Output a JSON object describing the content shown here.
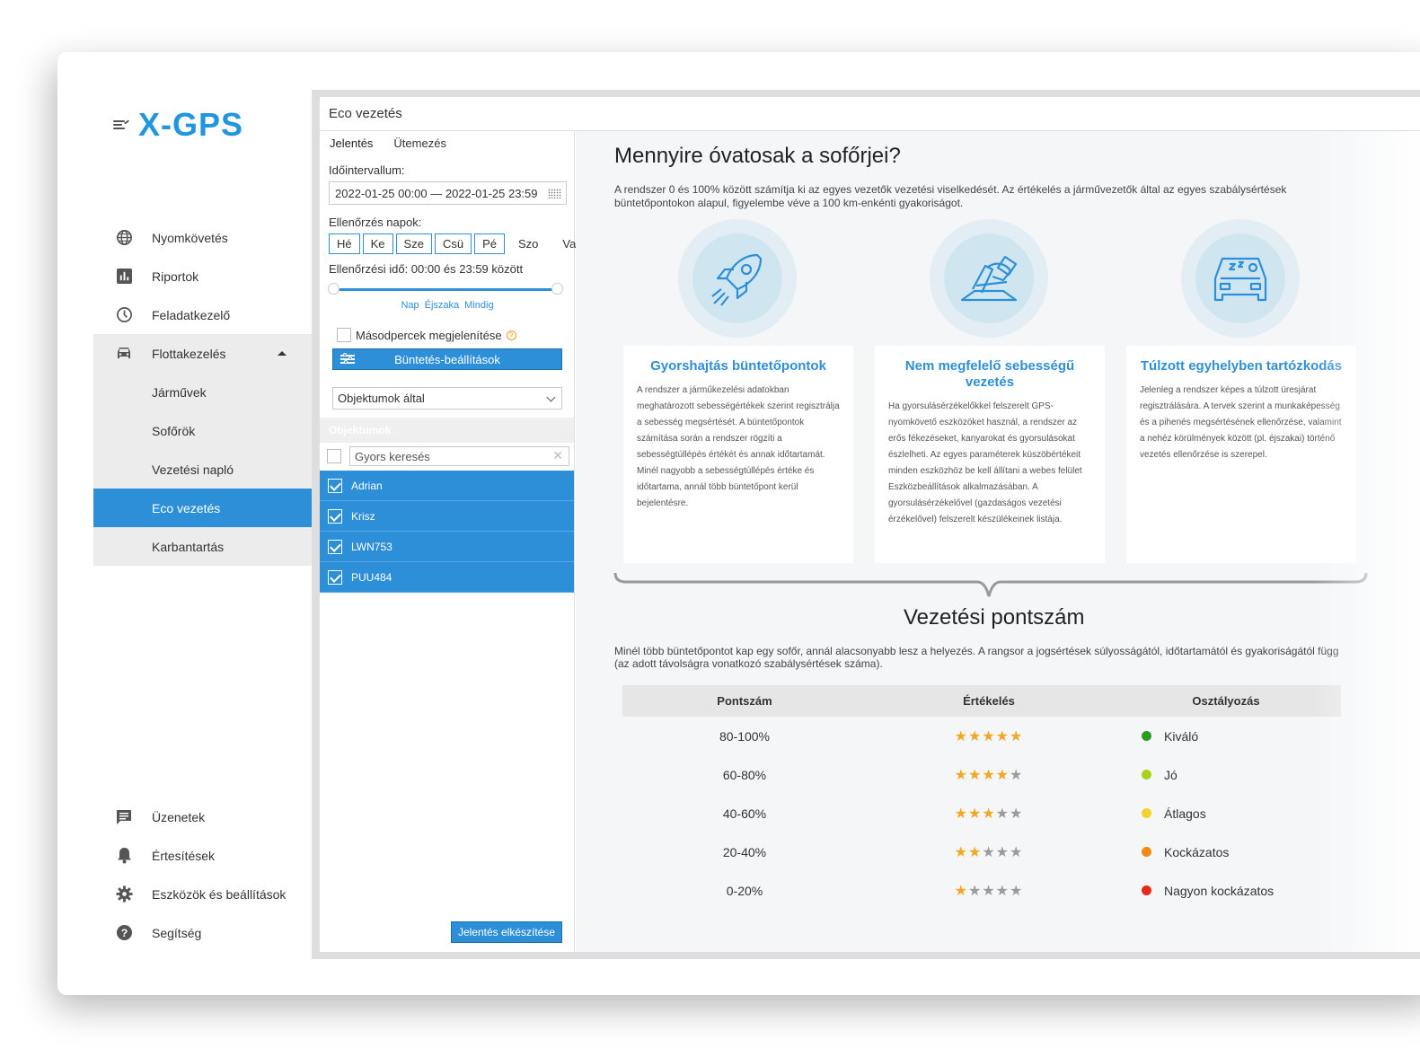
{
  "brand": "X-GPS",
  "sidebar": {
    "items": [
      {
        "label": "Nyomkövetés",
        "icon": "globe-icon"
      },
      {
        "label": "Riportok",
        "icon": "bar-chart-icon"
      },
      {
        "label": "Feladatkezelő",
        "icon": "clock-icon"
      },
      {
        "label": "Flottakezelés",
        "icon": "car-icon"
      }
    ],
    "sub_items": [
      "Járművek",
      "Sofőrök",
      "Vezetési napló",
      "Eco vezetés",
      "Karbantartás"
    ],
    "active_sub": "Eco vezetés",
    "bottom_items": [
      {
        "label": "Üzenetek",
        "icon": "message-icon"
      },
      {
        "label": "Értesítések",
        "icon": "bell-icon"
      },
      {
        "label": "Eszközök és beállítások",
        "icon": "gear-icon"
      },
      {
        "label": "Segítség",
        "icon": "help-icon"
      }
    ]
  },
  "panel": {
    "title": "Eco vezetés",
    "tabs": [
      "Jelentés",
      "Ütemezés"
    ],
    "interval_label": "Időintervallum:",
    "interval_value": "2022-01-25 00:00 — 2022-01-25 23:59",
    "days_label": "Ellenőrzés napok:",
    "days": [
      {
        "label": "Hé",
        "selected": true
      },
      {
        "label": "Ke",
        "selected": true
      },
      {
        "label": "Sze",
        "selected": true
      },
      {
        "label": "Csü",
        "selected": true
      },
      {
        "label": "Pé",
        "selected": true
      },
      {
        "label": "Szo",
        "selected": false
      },
      {
        "label": "Va",
        "selected": false
      }
    ],
    "time_label": "Ellenőrzési idő: 00:00 és 23:59 között",
    "time_presets": [
      "Nap",
      "Éjszaka",
      "Mindig"
    ],
    "seconds_label": "Másodpercek megjelenítése",
    "seconds_checked": false,
    "penalty_button": "Büntetés-beállítások",
    "group_select": "Objektumok által",
    "objects_header": "Objektumok",
    "search_placeholder": "Gyors keresés",
    "objects": [
      "Adrian",
      "Krisz",
      "LWN753",
      "PUU484"
    ],
    "report_button": "Jelentés elkészítése"
  },
  "content": {
    "heading": "Mennyire óvatosak a sofőrjei?",
    "intro": "A rendszer 0 és 100% között számítja ki az egyes vezetők vezetési viselkedését. Az értékelés a járművezetők által az egyes szabálysértések büntetőpontokon alapul, figyelembe véve a 100 km-enkénti gyakoriságot.",
    "cards": [
      {
        "title": "Gyorshajtás büntetőpontok",
        "icon": "rocket-icon",
        "text": "A rendszer a járműkezelési adatokban meghatározott sebességértékek szerint regisztrálja a sebesség megsértését. A büntetőpontok számítása során a rendszer rögzíti a sebességtúllépés értékét és annak időtartamát. Minél nagyobb a sebességtúllépés értéke és időtartama, annál több büntetőpont kerül bejelentésre."
      },
      {
        "title": "Nem megfelelő sebességű vezetés",
        "icon": "pedal-icon",
        "text": "Ha gyorsulásérzékelőkkel felszerelt GPS-nyomkövető eszközöket használ, a rendszer az erős fékezéseket, kanyarokat és gyorsulásokat észlelheti. Az egyes paraméterek küszöbértékeit minden eszközhöz be kell állítani a webes felület Eszközbeállítások alkalmazásában. A gyorsulásérzékelővel (gazdaságos vezetési érzékelővel) felszerelt készülékeinek listája."
      },
      {
        "title": "Túlzott egyhelyben tartózkodás",
        "icon": "sleeping-car-icon",
        "text": "Jelenleg a rendszer képes a túlzott üresjárat regisztrálására. A tervek szerint a munkaképesség és a pihenés megsértésének ellenőrzése, valamint a nehéz körülmények között (pl. éjszakai) történő vezetés ellenőrzése is szerepel."
      }
    ],
    "score_heading": "Vezetési pontszám",
    "score_intro": "Minél több büntetőpontot kap egy sofőr, annál alacsonyabb lesz a helyezés. A rangsor a jogsértések súlyosságától, időtartamától és gyakoriságától függ (az adott távolságra vonatkozó szabálysértések száma).",
    "table_headers": [
      "Pontszám",
      "Értékelés",
      "Osztályozás"
    ],
    "table_rows": [
      {
        "range": "80-100%",
        "stars": 5,
        "class": "Kiváló",
        "color": "#2a9d1f"
      },
      {
        "range": "60-80%",
        "stars": 4,
        "class": "Jó",
        "color": "#a8d21c"
      },
      {
        "range": "40-60%",
        "stars": 3,
        "class": "Átlagos",
        "color": "#f2d32b"
      },
      {
        "range": "20-40%",
        "stars": 2,
        "class": "Kockázatos",
        "color": "#f28a14"
      },
      {
        "range": "0-20%",
        "stars": 1,
        "class": "Nagyon kockázatos",
        "color": "#e52a1c"
      }
    ]
  },
  "colors": {
    "accent": "#2e8fd9",
    "brand": "#2196e0",
    "star": "#f5a623"
  }
}
